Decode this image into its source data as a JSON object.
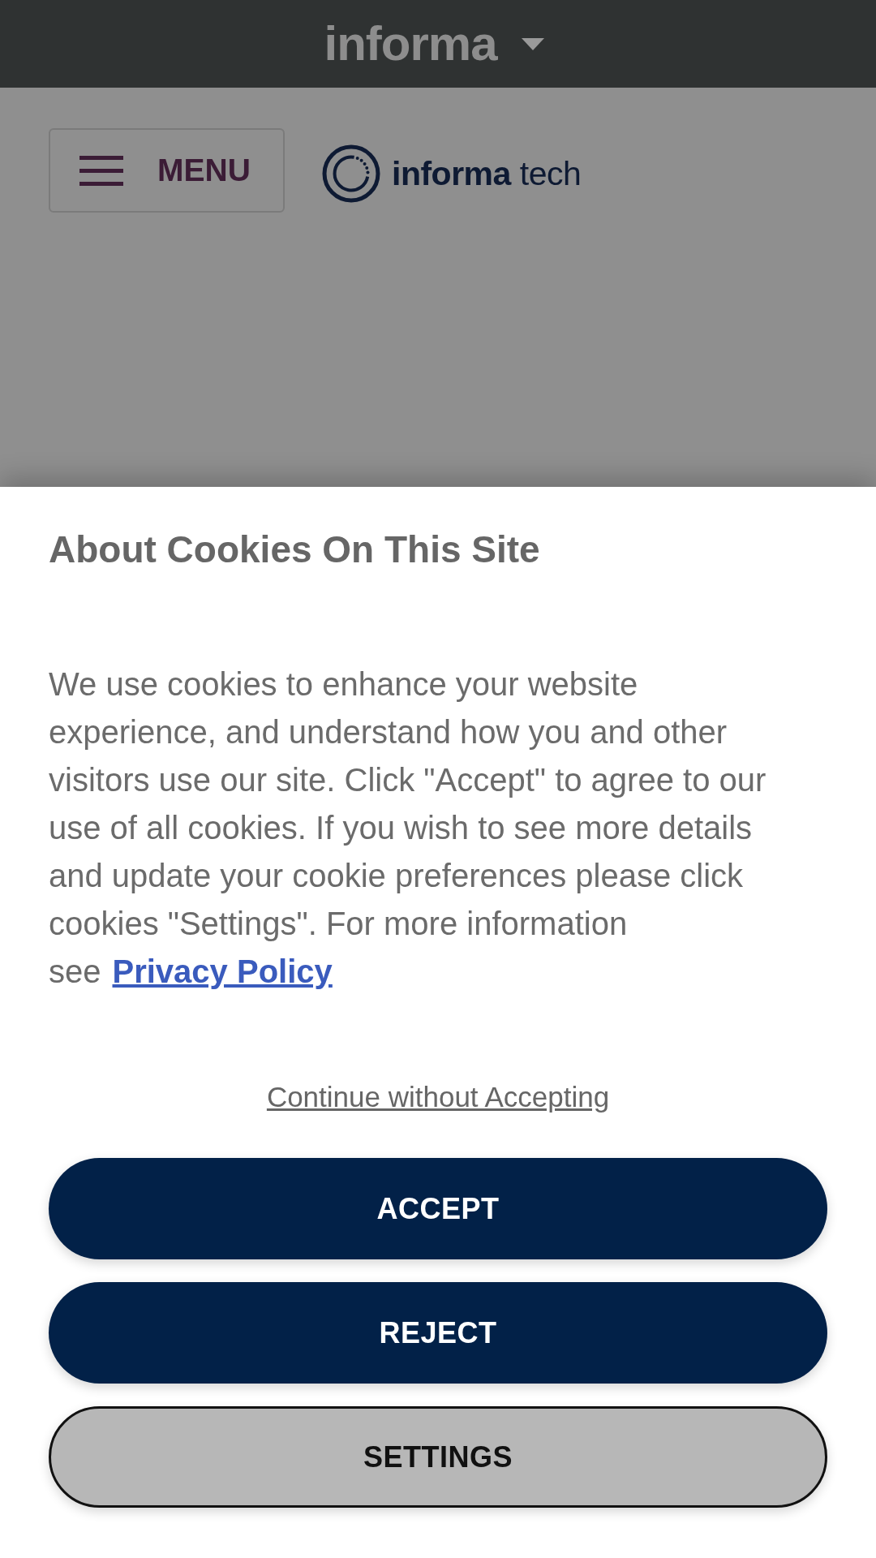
{
  "top_bar": {
    "brand": "informa"
  },
  "header": {
    "menu_button": {
      "label": "MENU"
    },
    "logo": {
      "wordmark": "**informa** tech"
    }
  },
  "cookie_banner": {
    "title": "About Cookies On This Site",
    "message": "We use cookies to enhance your website\nexperience, and understand how you and other\nvisitors use our site. Click \"Accept\" to agree to our\nuse of all cookies. If you wish to see more details\nand update your cookie preferences please click\ncookies \"Settings\". For more information\nsee",
    "privacy_link": "Privacy Policy",
    "continue_link": "Continue without Accepting",
    "buttons": [
      {
        "label": "ACCEPT",
        "kind": "primary"
      },
      {
        "label": "REJECT",
        "kind": "primary"
      },
      {
        "label": "SETTINGS",
        "kind": "secondary"
      }
    ]
  }
}
